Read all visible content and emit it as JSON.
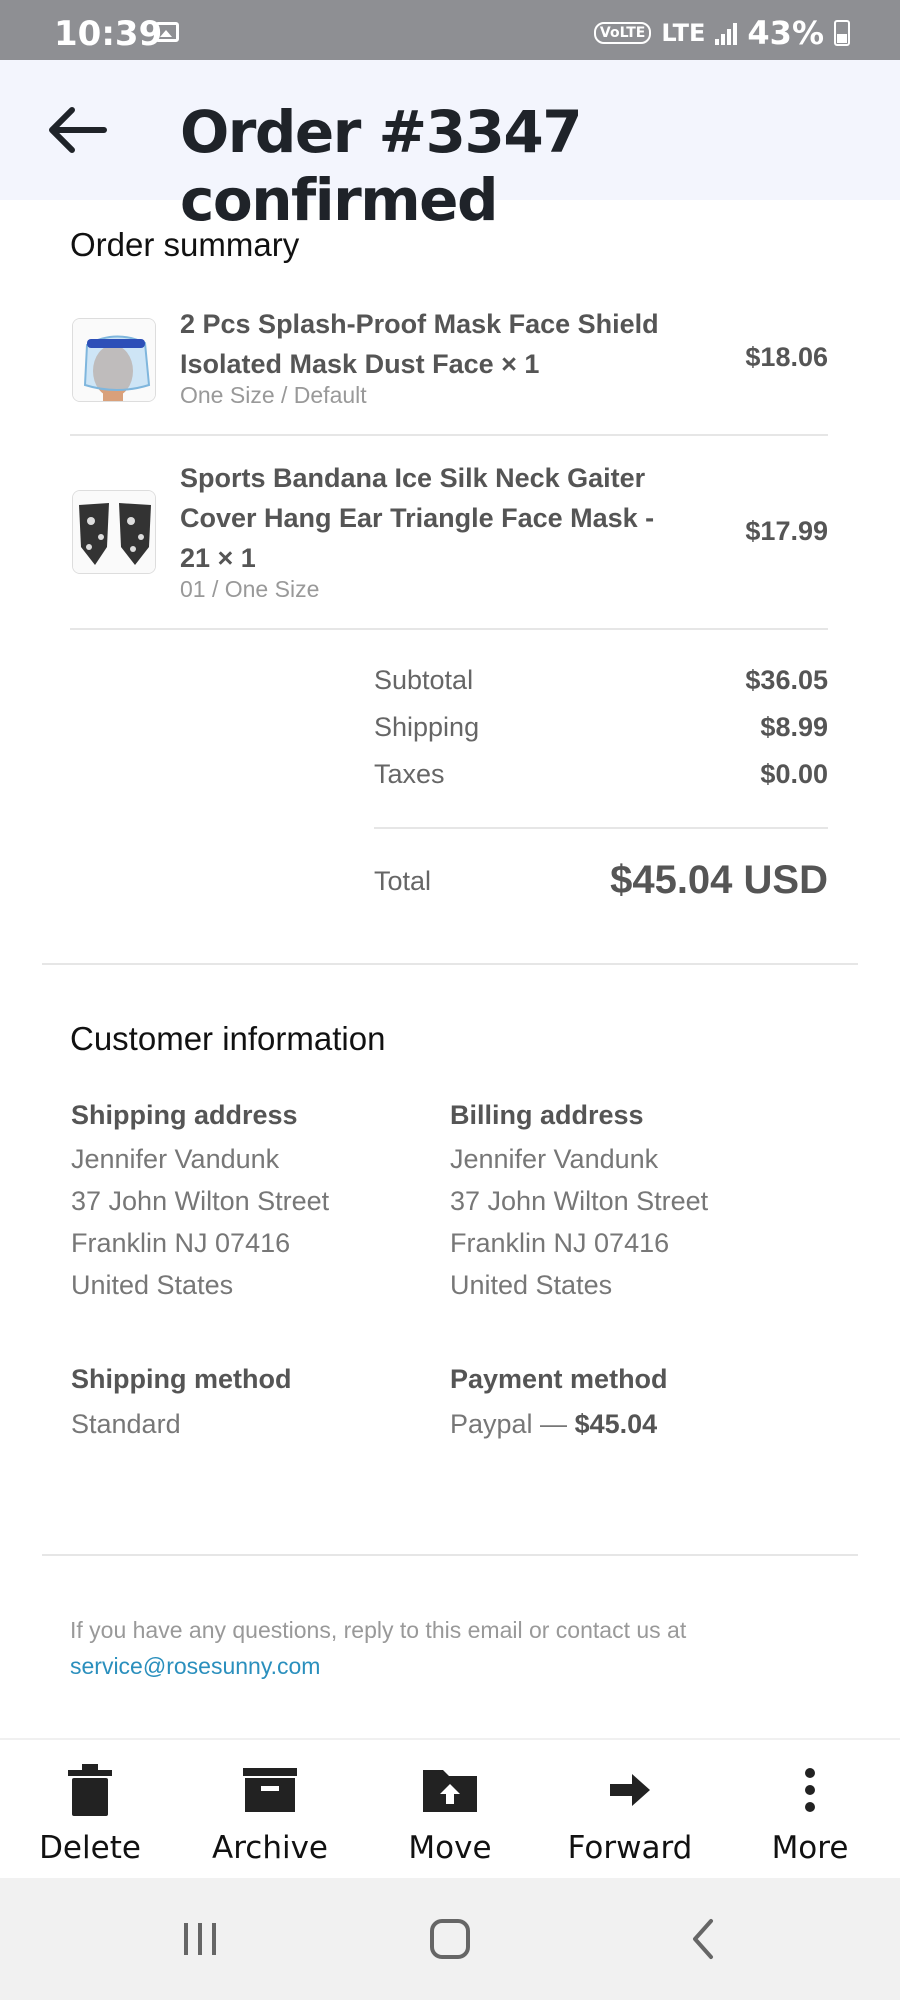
{
  "status_bar": {
    "time": "10:39",
    "network_badge": "VoLTE",
    "network": "LTE",
    "battery": "43%"
  },
  "header": {
    "title": "Order #3347 confirmed"
  },
  "order_summary": {
    "title": "Order summary",
    "items": [
      {
        "name": "2 Pcs Splash-Proof Mask Face Shield Isolated Mask Dust Face × 1",
        "variant": "One Size / Default",
        "price": "$18.06",
        "icon": "face-shield-image"
      },
      {
        "name": "Sports Bandana Ice Silk Neck Gaiter Cover Hang Ear Triangle Face Mask - 21 × 1",
        "variant": "01 / One Size",
        "price": "$17.99",
        "icon": "bandana-mask-image"
      }
    ],
    "costs": {
      "subtotal_label": "Subtotal",
      "subtotal": "$36.05",
      "shipping_label": "Shipping",
      "shipping": "$8.99",
      "taxes_label": "Taxes",
      "taxes": "$0.00",
      "total_label": "Total",
      "total": "$45.04 USD"
    }
  },
  "customer_info": {
    "title": "Customer information",
    "shipping_address": {
      "label": "Shipping address",
      "name": "Jennifer Vandunk",
      "street": "37 John Wilton Street",
      "city": "Franklin NJ 07416",
      "country": "United States"
    },
    "billing_address": {
      "label": "Billing address",
      "name": "Jennifer Vandunk",
      "street": "37 John Wilton Street",
      "city": "Franklin NJ 07416",
      "country": "United States"
    },
    "shipping_method": {
      "label": "Shipping method",
      "value": "Standard"
    },
    "payment_method": {
      "label": "Payment method",
      "value": "Paypal —",
      "amount": "$45.04"
    }
  },
  "footer": {
    "note": "If you have any questions, reply to this email or contact us at",
    "email": "service@rosesunny.com",
    "link_color": "#2a8fbd"
  },
  "actions": {
    "delete": "Delete",
    "archive": "Archive",
    "move": "Move",
    "forward": "Forward",
    "more": "More"
  }
}
